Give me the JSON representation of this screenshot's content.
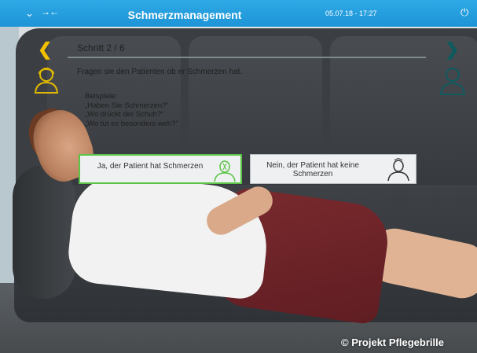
{
  "header": {
    "title": "Schmerzmanagement",
    "datetime": "05.07.18 - 17:27"
  },
  "icons": {
    "menu": "chevron-down-icon",
    "arrows": "swap-arrows-icon",
    "power": "power-icon",
    "prev": "chevron-left-icon",
    "next": "chevron-right-icon",
    "nurse": "nurse-head-icon",
    "patient": "patient-head-icon"
  },
  "step": {
    "label": "Schritt 2 / 6"
  },
  "instruction": "Fragen sie den Patienten ob er Schmerzen hat.",
  "examples": {
    "heading": "Beispiele:",
    "items": [
      "„Haben Sie Schmerzen?“",
      "„Wo drückt der Schuh?“",
      "„Wo tut es besonders weh?“"
    ]
  },
  "answers": {
    "yes": "Ja, der Patient hat Schmerzen",
    "no": "Nein, der Patient hat keine Schmerzen"
  },
  "colors": {
    "topbar": "#1d94d6",
    "prev_arrow": "#f2c200",
    "next_arrow": "#0e5a5f",
    "yes_border": "#59c445"
  },
  "watermark": "© Projekt Pflegebrille"
}
